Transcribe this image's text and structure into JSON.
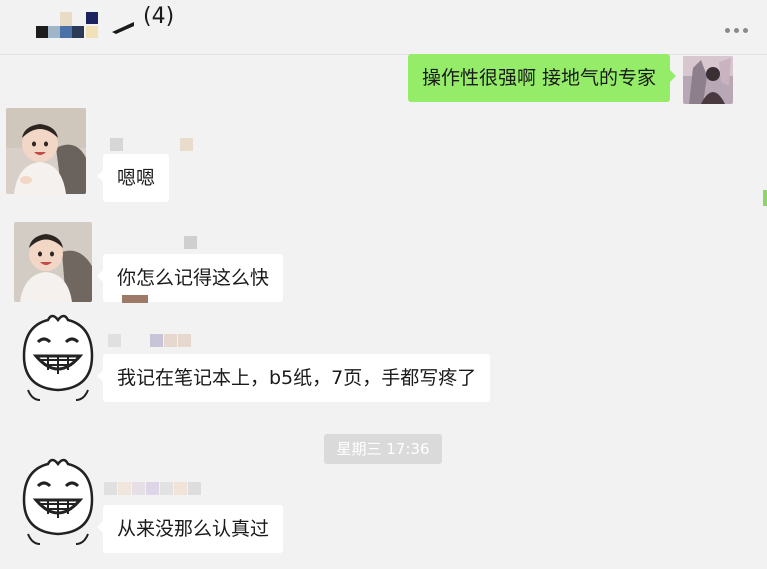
{
  "header": {
    "member_count": "(4)",
    "more_icon": "more-dots-icon"
  },
  "messages": [
    {
      "side": "right",
      "text": "操作性很强啊 接地气的专家",
      "avatar": "woman-photo-avatar"
    },
    {
      "side": "left",
      "text": "嗯嗯",
      "avatar": "toddler-photo-avatar"
    },
    {
      "side": "left",
      "text": "你怎么记得这么快",
      "avatar": "toddler-photo-avatar"
    },
    {
      "side": "left",
      "text": "我记在笔记本上，b5纸，7页，手都写疼了",
      "avatar": "cartoon-face-avatar"
    },
    {
      "side": "left",
      "text": "从来没那么认真过",
      "avatar": "cartoon-face-avatar"
    }
  ],
  "timestamp": "星期三 17:36",
  "colors": {
    "background": "#f2f2f2",
    "self_bubble": "#95ec69",
    "other_bubble": "#ffffff",
    "timestamp_bg": "#dadada"
  }
}
